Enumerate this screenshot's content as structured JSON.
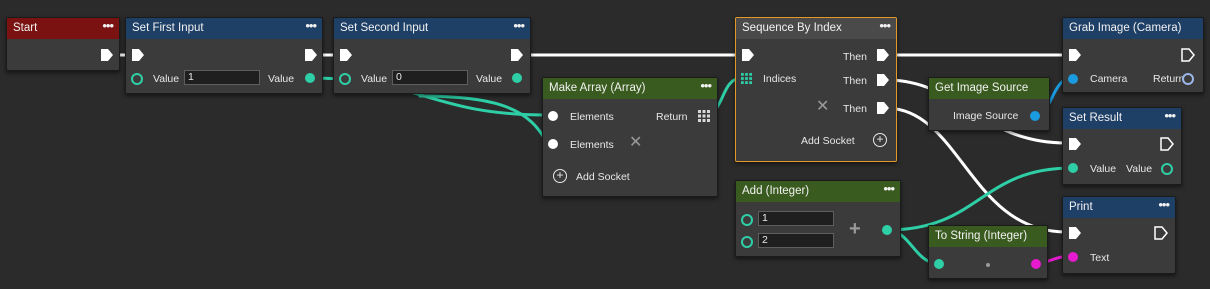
{
  "colors": {
    "exec": "#ffffff",
    "int": "#2ecfa6",
    "image": "#1a9be0",
    "string": "#e61acf",
    "selected": "#e39a28"
  },
  "nodes": {
    "start": {
      "title": "Start"
    },
    "set_first": {
      "title": "Set First Input",
      "value_label": "Value",
      "value": "1",
      "out_label": "Value"
    },
    "set_second": {
      "title": "Set Second Input",
      "value_label": "Value",
      "value": "0",
      "out_label": "Value"
    },
    "make_array": {
      "title": "Make Array (Array)",
      "elements1": "Elements",
      "elements2": "Elements",
      "return_label": "Return",
      "add_socket": "Add Socket"
    },
    "sequence": {
      "title": "Sequence By Index",
      "then1": "Then",
      "then2": "Then",
      "then3": "Then",
      "indices": "Indices",
      "add_socket": "Add Socket"
    },
    "get_image_source": {
      "title": "Get Image Source",
      "out_label": "Image Source"
    },
    "grab_image": {
      "title": "Grab Image (Camera)",
      "camera": "Camera",
      "return_label": "Return"
    },
    "set_result": {
      "title": "Set Result",
      "value_in": "Value",
      "value_out": "Value"
    },
    "add_integer": {
      "title": "Add (Integer)",
      "a": "1",
      "b": "2"
    },
    "to_string": {
      "title": "To String (Integer)"
    },
    "print": {
      "title": "Print",
      "text": "Text"
    }
  }
}
